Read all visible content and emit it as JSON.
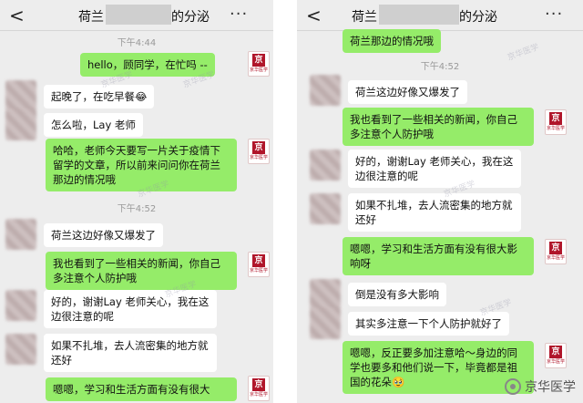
{
  "left": {
    "header": {
      "back": "<",
      "title_prefix": "荷兰",
      "title_suffix": "的分泌",
      "more": "···"
    },
    "time1": "下午4:44",
    "time2": "下午4:52",
    "messages": [
      {
        "text": "hello，顾同学，在忙吗 --"
      },
      {
        "text": "起晚了，在吃早餐😂"
      },
      {
        "text": "怎么啦，Lay 老师"
      },
      {
        "text": "哈哈，老师今天要写一片关于疫情下留学的文章，所以前来问问你在荷兰那边的情况哦"
      },
      {
        "text": "荷兰这边好像又爆发了"
      },
      {
        "text": "我也看到了一些相关的新闻，你自己多注意个人防护哦"
      },
      {
        "text": "好的，谢谢Lay 老师关心，我在这边很注意的呢"
      },
      {
        "text": "如果不扎堆，去人流密集的地方就还好"
      },
      {
        "text": "嗯嗯，学习和生活方面有没有很大"
      }
    ]
  },
  "right": {
    "header": {
      "back": "<",
      "title_prefix": "荷兰",
      "title_suffix": "的分泌",
      "more": "···"
    },
    "time1": "下午4:52",
    "messages": [
      {
        "text": "荷兰那边的情况哦"
      },
      {
        "text": "荷兰这边好像又爆发了"
      },
      {
        "text": "我也看到了一些相关的新闻，你自己多注意个人防护哦"
      },
      {
        "text": "好的，谢谢Lay 老师关心，我在这边很注意的呢"
      },
      {
        "text": "如果不扎堆，去人流密集的地方就还好"
      },
      {
        "text": "嗯嗯，学习和生活方面有没有很大影响呀"
      },
      {
        "text": "倒是没有多大影响"
      },
      {
        "text": "其实多注意一下个人防护就好了"
      },
      {
        "text": "嗯嗯，反正要多加注意哈～身边的同学也要多和他们说一下，毕竟都是祖国的花朵🥹"
      }
    ]
  },
  "logo": {
    "mark": "京",
    "caption": "京华医学"
  },
  "watermark_text": "京华医学",
  "brand": {
    "name": "京华医学"
  }
}
